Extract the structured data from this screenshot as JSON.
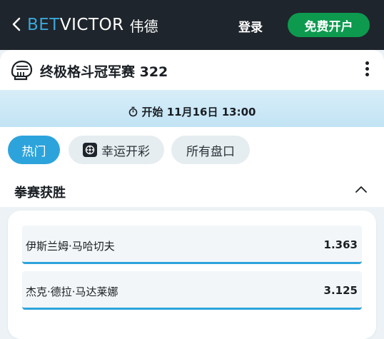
{
  "header": {
    "logo_bet": "BET",
    "logo_victor": "VICTOR",
    "logo_cn": "伟德",
    "login_label": "登录",
    "register_label": "免费开户",
    "brand_color": "#3aa7d8",
    "register_color": "#0d9a4f"
  },
  "event": {
    "title": "终极格斗冠军赛 322",
    "start_label": "开始 11月16日 13:00",
    "sport_icon": "ufc-glove-icon"
  },
  "tabs": [
    {
      "label": "热门",
      "active": true
    },
    {
      "label": "幸运开彩",
      "icon": "lucky-draw-icon",
      "active": false
    },
    {
      "label": "所有盘口",
      "active": false
    }
  ],
  "market": {
    "title": "拳赛获胜",
    "expanded": true,
    "selections": [
      {
        "name": "伊斯兰姆·马哈切夫",
        "odds": "1.363"
      },
      {
        "name": "杰克·德拉·马达莱娜",
        "odds": "3.125"
      }
    ]
  },
  "colors": {
    "accent": "#2da3dc",
    "header_bg": "#1f252c"
  }
}
